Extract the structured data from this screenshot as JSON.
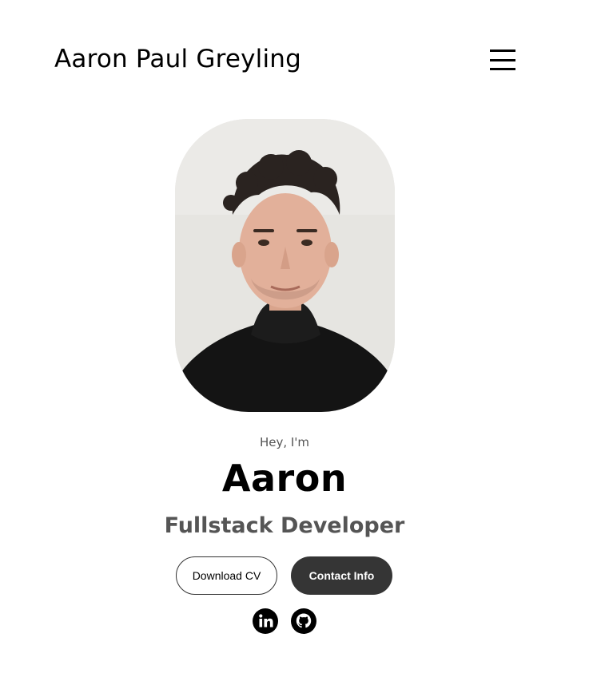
{
  "header": {
    "logo_text": "Aaron Paul Greyling",
    "menu_icon": "hamburger-menu-icon"
  },
  "profile": {
    "photo_alt": "Profile picture of Aaron",
    "greeting": "Hey, I'm",
    "name": "Aaron",
    "role": "Fullstack Developer"
  },
  "actions": {
    "download_cv_label": "Download CV",
    "contact_info_label": "Contact Info"
  },
  "socials": [
    {
      "icon": "linkedin-icon"
    },
    {
      "icon": "github-icon"
    }
  ],
  "colors": {
    "text_primary": "#000000",
    "text_secondary": "#555555",
    "button_dark": "#353535"
  }
}
